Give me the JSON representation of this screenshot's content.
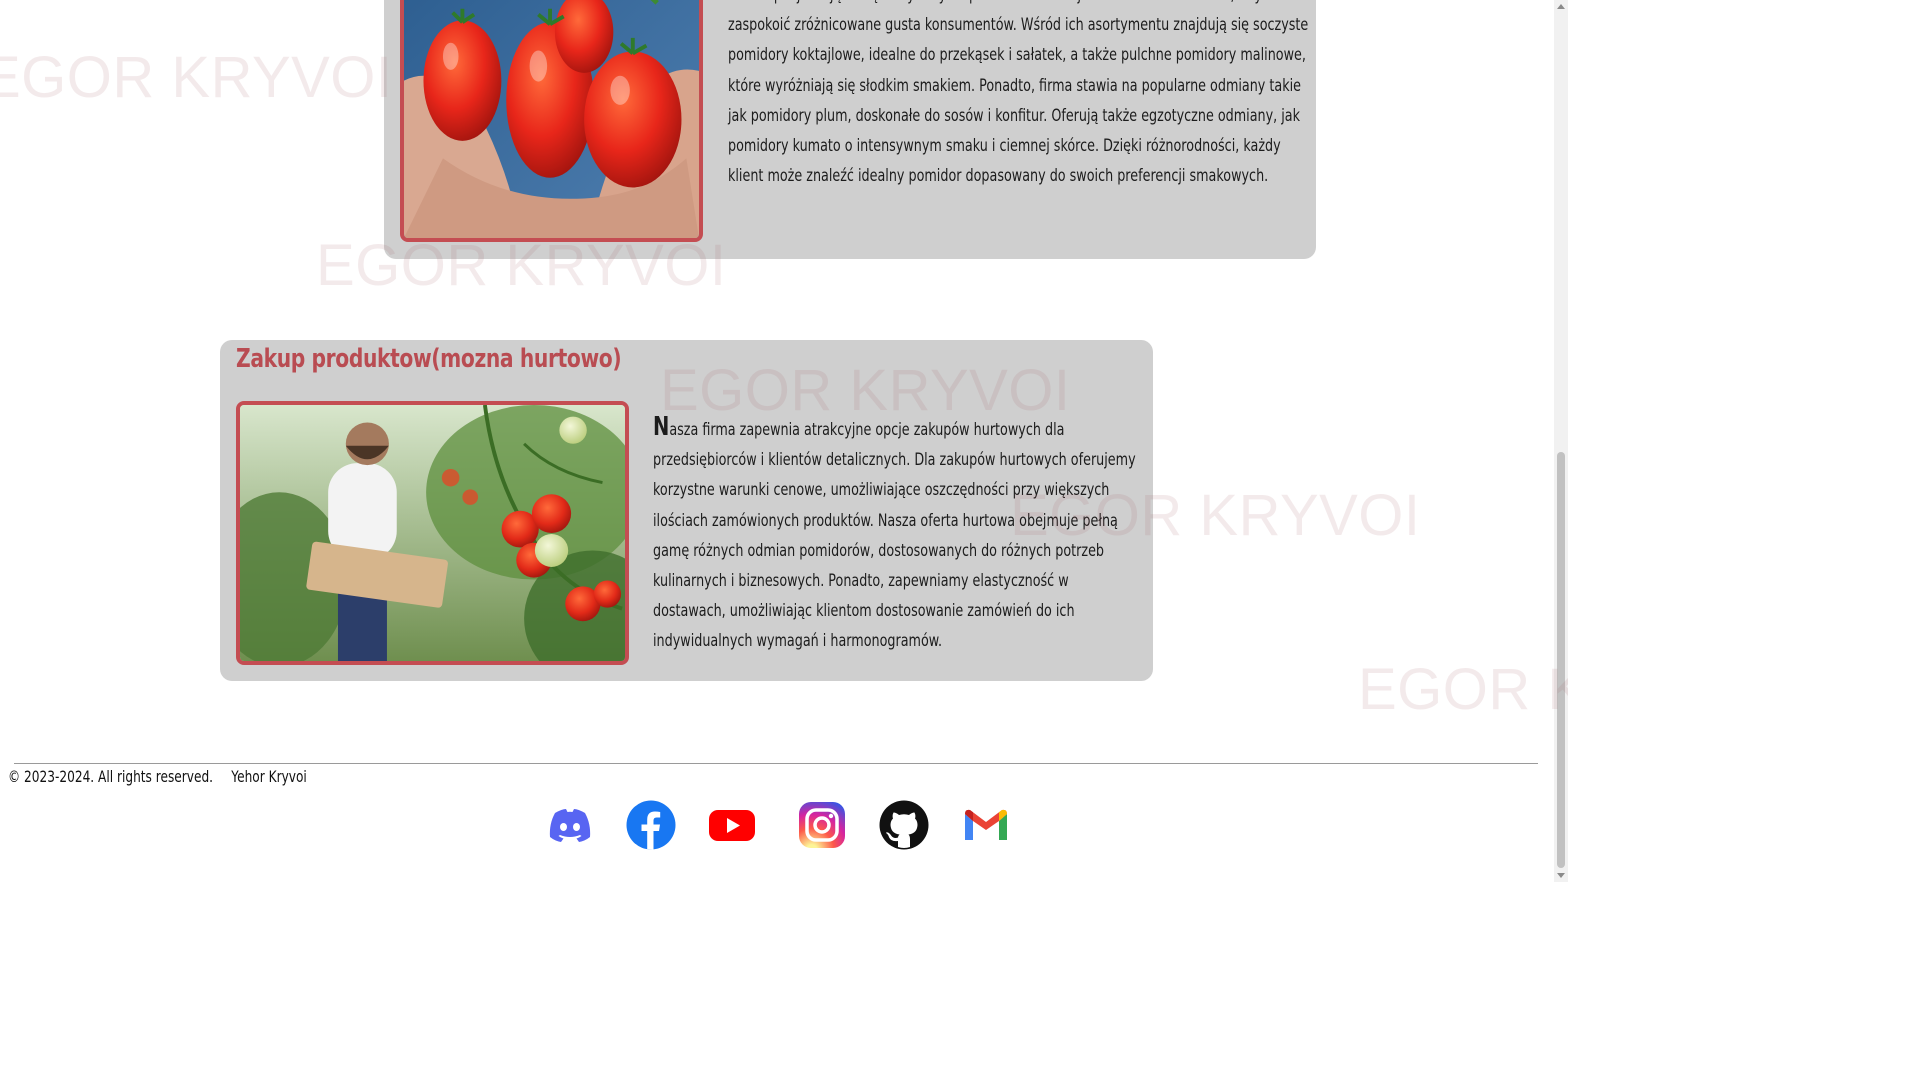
{
  "watermark_text": "EGOR KRYVOI",
  "section_producer": {
    "image_alt": "tomatoes-in-hands",
    "text": "Firma specjalizująca się w wydobyciu pomidorów oferuje różnorodność odmian, aby zaspokoić zróżnicowane gusta konsumentów. Wśród ich asortymentu znajdują się soczyste pomidory koktajlowe, idealne do przekąsek i sałatek, a także pulchne pomidory malinowe, które wyróżniają się słodkim smakiem. Ponadto, firma stawia na popularne odmiany takie jak pomidory plum, doskonałe do sosów i konfitur. Oferują także egzotyczne odmiany, jak pomidory kumato o intensywnym smaku i ciemnej skórce. Dzięki różnorodności, każdy klient może znaleźć idealny pomidor dopasowany do swoich preferencji smakowych."
  },
  "section_purchase": {
    "title": "Zakup produktow(mozna hurtowo)",
    "image_alt": "farmer-in-greenhouse",
    "text": "Nasza firma zapewnia atrakcyjne opcje zakupów hurtowych dla przedsiębiorców i klientów detalicznych. Dla zakupów hurtowych oferujemy korzystne warunki cenowe, umożliwiające oszczędności przy większych ilościach zamówionych produktów. Nasza oferta hurtowa obejmuje pełną gamę różnych odmian pomidorów, dostosowanych do różnych potrzeb kulinarnych i biznesowych. Ponadto, zapewniamy elastyczność w dostawach, umożliwiając klientom dostosowanie zamówień do ich indywidualnych wymagań i harmonogramów."
  },
  "footer": {
    "copyright": "© 2023-2024. All rights reserved.",
    "author": "Yehor Kryvoi",
    "social": [
      {
        "name": "discord-icon",
        "color": "#5865F2"
      },
      {
        "name": "facebook-icon",
        "color": "#1877F2"
      },
      {
        "name": "youtube-icon",
        "color": "#FF0000"
      },
      {
        "name": "instagram-icon",
        "color": "#E1306C"
      },
      {
        "name": "github-icon",
        "color": "#000000"
      },
      {
        "name": "gmail-icon",
        "color": "#EA4335"
      }
    ]
  },
  "colors": {
    "card_bg": "#cfcfcf",
    "accent": "#b94c52",
    "photo_border": "#c44d52"
  }
}
